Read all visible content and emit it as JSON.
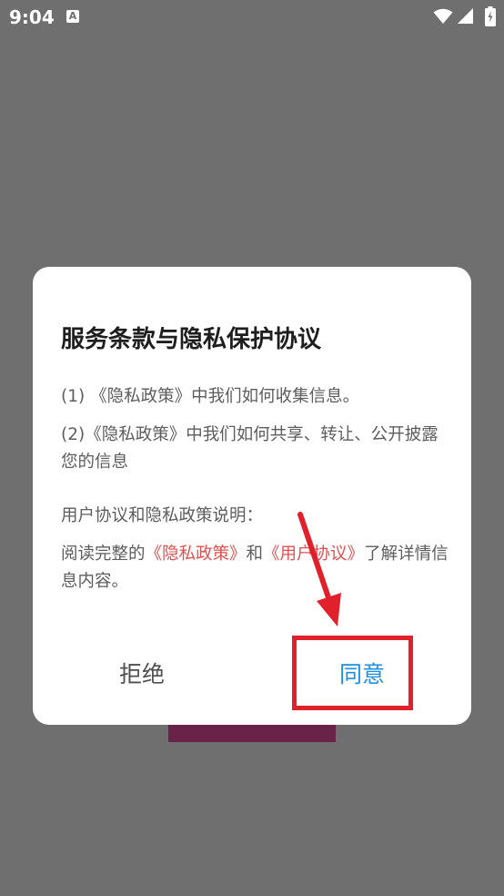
{
  "status_bar": {
    "time": "9:04",
    "notification_icon": "A"
  },
  "dialog": {
    "title": "服务条款与隐私保护协议",
    "item1": "(1) 《隐私政策》中我们如何收集信息。",
    "item2": "(2)《隐私政策》中我们如何共享、转让、公开披露您的信息",
    "section_title": "用户协议和隐私政策说明：",
    "desc_prefix": "阅读完整的",
    "privacy_link": "《隐私政策》",
    "desc_and": "和",
    "user_link": "《用户协议》",
    "desc_suffix": "了解详情信息内容。",
    "reject_label": "拒绝",
    "agree_label": "同意"
  },
  "colors": {
    "link": "#e05050",
    "agree": "#1c8fe0",
    "annotation": "#e0202a",
    "overlay": "#6f6f6f"
  },
  "icons": [
    "wifi-icon",
    "signal-icon",
    "battery-icon"
  ]
}
